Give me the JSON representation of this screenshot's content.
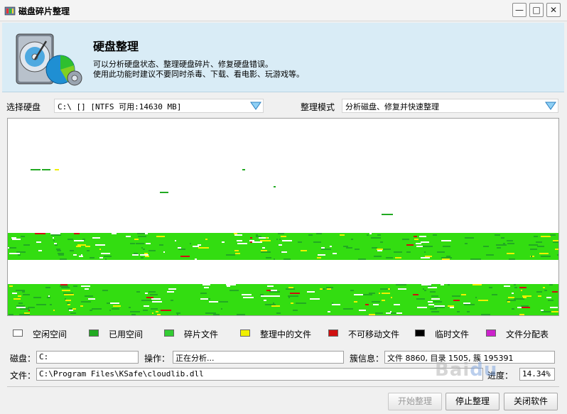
{
  "window": {
    "title": "磁盘碎片整理",
    "min_glyph": "—",
    "max_glyph": "□",
    "close_glyph": "✕"
  },
  "header": {
    "title": "硬盘整理",
    "desc_line1": "可以分析硬盘状态、整理硬盘碎片、修复硬盘错误。",
    "desc_line2": "使用此功能时建议不要同时杀毒、下载、看电影、玩游戏等。",
    "icon": "hard-disk-icon"
  },
  "disk_select": {
    "label": "选择硬盘",
    "value": "C:\\ [] [NTFS 可用:14630 MB]"
  },
  "mode_select": {
    "label": "整理模式",
    "value": "分析磁盘、修复并快速整理"
  },
  "colors": {
    "free": "#ffffff",
    "used": "#22aa22",
    "fragmented": "#33dd11",
    "defragmenting": "#f0f000",
    "unmovable": "#d01010",
    "temp": "#000000",
    "mft": "#cc22cc"
  },
  "legend": [
    {
      "label": "空闲空间",
      "color": "#ffffff"
    },
    {
      "label": "已用空间",
      "color": "#22aa22"
    },
    {
      "label": "碎片文件",
      "color": "#33cc33"
    },
    {
      "label": "整理中的文件",
      "color": "#f0f000"
    },
    {
      "label": "不可移动文件",
      "color": "#d01010"
    },
    {
      "label": "临时文件",
      "color": "#000000"
    },
    {
      "label": "文件分配表",
      "color": "#cc22cc"
    }
  ],
  "status": {
    "disk_label": "磁盘：",
    "disk_value": "C:",
    "operation_label": "操作：",
    "operation_value": "正在分析...",
    "cluster_label": "簇信息：",
    "cluster_value": "文件 8860, 目录 1505, 簇 195391",
    "file_label": "文件：",
    "file_value": "C:\\Program Files\\KSafe\\cloudlib.dll",
    "progress_label": "进度：",
    "progress_value": "14.34%"
  },
  "buttons": {
    "start": "开始整理",
    "stop": "停止整理",
    "close": "关闭软件"
  }
}
